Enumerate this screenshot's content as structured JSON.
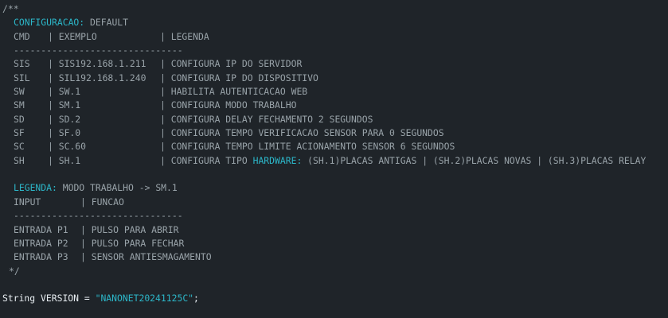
{
  "comment": {
    "open": "/**",
    "config_key": "CONFIGURACAO:",
    "config_value": " DEFAULT",
    "header": {
      "col1": "CMD",
      "col2": "| EXEMPLO",
      "col3": "| LEGENDA"
    },
    "separator": "-------------------------------",
    "rows": [
      {
        "cmd": "SIS",
        "example": "| SIS192.168.1.211",
        "legend": "| CONFIGURA IP DO SERVIDOR"
      },
      {
        "cmd": "SIL",
        "example": "| SIL192.168.1.240",
        "legend": "| CONFIGURA IP DO DISPOSITIVO"
      },
      {
        "cmd": "SW",
        "example": "| SW.1",
        "legend": "| HABILITA AUTENTICACAO WEB"
      },
      {
        "cmd": "SM",
        "example": "| SM.1",
        "legend": "| CONFIGURA MODO TRABALHO"
      },
      {
        "cmd": "SD",
        "example": "| SD.2",
        "legend": "| CONFIGURA DELAY FECHAMENTO 2 SEGUNDOS"
      },
      {
        "cmd": "SF",
        "example": "| SF.0",
        "legend": "| CONFIGURA TEMPO VERIFICACAO SENSOR PARA 0 SEGUNDOS"
      },
      {
        "cmd": "SC",
        "example": "| SC.60",
        "legend": "| CONFIGURA TEMPO LIMITE ACIONAMENTO SENSOR 6 SEGUNDOS"
      }
    ],
    "sh_row": {
      "cmd": "SH",
      "example": "| SH.1",
      "legend_pre": "| CONFIGURA TIPO ",
      "legend_kw": "HARDWARE:",
      "legend_post": " (SH.1)PLACAS ANTIGAS | (SH.2)PLACAS NOVAS | (SH.3)PLACAS RELAY"
    },
    "legenda_key": "LEGENDA:",
    "legenda_value": " MODO TRABALHO -> SM.1",
    "header2": {
      "col1": "INPUT",
      "col2": "| FUNCAO"
    },
    "separator2": "-------------------------------",
    "rows2": [
      {
        "input": "ENTRADA P1",
        "func": "| PULSO PARA ABRIR"
      },
      {
        "input": "ENTRADA P2",
        "func": "| PULSO PARA FECHAR"
      },
      {
        "input": "ENTRADA P3",
        "func": "| SENSOR ANTIESMAGAMENTO"
      }
    ],
    "close": "*/"
  },
  "code": {
    "type": "String",
    "name": " VERSION = ",
    "value": "\"NANONET20241125C\"",
    "end": ";"
  },
  "colors": {
    "background": "#1f2429",
    "comment": "#99a3a9",
    "keyword": "#2cb6c8",
    "plain": "#e8eef2"
  }
}
